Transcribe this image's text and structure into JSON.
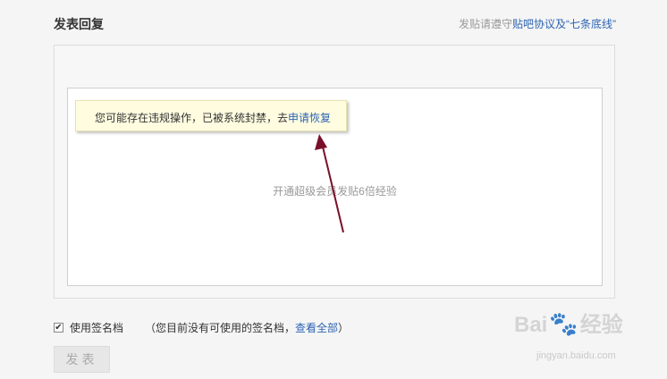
{
  "header": {
    "title": "发表回复",
    "rules_prefix": "发贴请遵守",
    "rules_link": "贴吧协议及“七条底线”"
  },
  "editor": {
    "hint": "开通超级会员发贴6倍经验"
  },
  "tooltip": {
    "text": "您可能存在违规操作，已被系统封禁，去",
    "link": "申请恢复"
  },
  "signature": {
    "checked": true,
    "label": "使用签名档",
    "note_prefix": "（您目前没有可使用的签名档，",
    "note_link": "查看全部",
    "note_suffix": "）"
  },
  "submit": {
    "label": "发表"
  },
  "watermark": {
    "text_left": "Bai",
    "text_right": "经验",
    "url": "jingyan.baidu.com"
  },
  "colors": {
    "link": "#2d64b3",
    "arrow": "#7a0f2a",
    "tooltip_bg": "#fffce0"
  }
}
